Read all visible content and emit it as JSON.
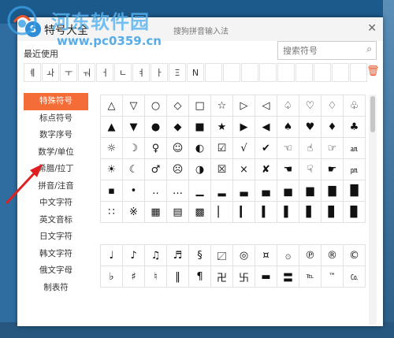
{
  "window": {
    "title": "特号大全",
    "subtitle": "搜狗拼音输入法",
    "close_glyph": "✕",
    "logo_glyph": "S"
  },
  "search": {
    "placeholder": "搜索符号",
    "icon": "search-icon"
  },
  "recent": {
    "label": "最近使用",
    "symbols": [
      "ㅖ",
      "ㅘ",
      "ㅜ",
      "ㅝ",
      "ㅓ",
      "ㄴ",
      "ㅕ",
      "ㅏ",
      "Ξ",
      "N",
      "",
      "",
      "",
      "",
      "",
      "",
      "",
      "",
      ""
    ],
    "delete_icon": "trash-icon",
    "delete_glyph": "🗑"
  },
  "sidebar": {
    "items": [
      {
        "label": "特殊符号",
        "active": true
      },
      {
        "label": "标点符号"
      },
      {
        "label": "数字序号"
      },
      {
        "label": "数学/单位"
      },
      {
        "label": "希腊/拉丁"
      },
      {
        "label": "拼音/注音"
      },
      {
        "label": "中文字符"
      },
      {
        "label": "英文音标"
      },
      {
        "label": "日文字符"
      },
      {
        "label": "韩文字符"
      },
      {
        "label": "俄文字母"
      },
      {
        "label": "制表符"
      }
    ]
  },
  "symbols": {
    "rows": [
      [
        "△",
        "▽",
        "○",
        "◇",
        "□",
        "☆",
        "▷",
        "◁",
        "♤",
        "♡",
        "♢",
        "♧"
      ],
      [
        "▲",
        "▼",
        "●",
        "◆",
        "■",
        "★",
        "▶",
        "◀",
        "♠",
        "♥",
        "♦",
        "♣"
      ],
      [
        "☼",
        "☽",
        "♀",
        "☺",
        "◐",
        "☑",
        "√",
        "✔",
        "☜",
        "☝",
        "☞",
        "㏂"
      ],
      [
        "☀",
        "☾",
        "♂",
        "☹",
        "◑",
        "☒",
        "×",
        "✘",
        "☚",
        "☟",
        "☛",
        "㏘"
      ],
      [
        "▪",
        "•",
        "‥",
        "…",
        "▁",
        "▂",
        "▃",
        "▄",
        "▅",
        "▆",
        "▇",
        "█"
      ],
      [
        "∷",
        "※",
        "▦",
        "▤",
        "▩",
        "▏",
        "▎",
        "▍",
        "▌",
        "▋",
        "▊",
        "▉"
      ],
      [
        "",
        "",
        "",
        "",
        "",
        "",
        "",
        "",
        "",
        "",
        "",
        ""
      ],
      [
        "♩",
        "♪",
        "♫",
        "♬",
        "§",
        "〼",
        "◎",
        "¤",
        "۞",
        "℗",
        "®",
        "©"
      ],
      [
        "♭",
        "♯",
        "♮",
        "‖",
        "¶",
        "卍",
        "卐",
        "▬",
        "〓",
        "℡",
        "™",
        "㏇"
      ]
    ]
  },
  "watermark": {
    "site_name": "河东软件园",
    "url": "www.pc0359.cn"
  },
  "colors": {
    "accent": "#f46c36",
    "watermark_blue": "#3aa0e6",
    "arrow_red": "#e02020"
  }
}
